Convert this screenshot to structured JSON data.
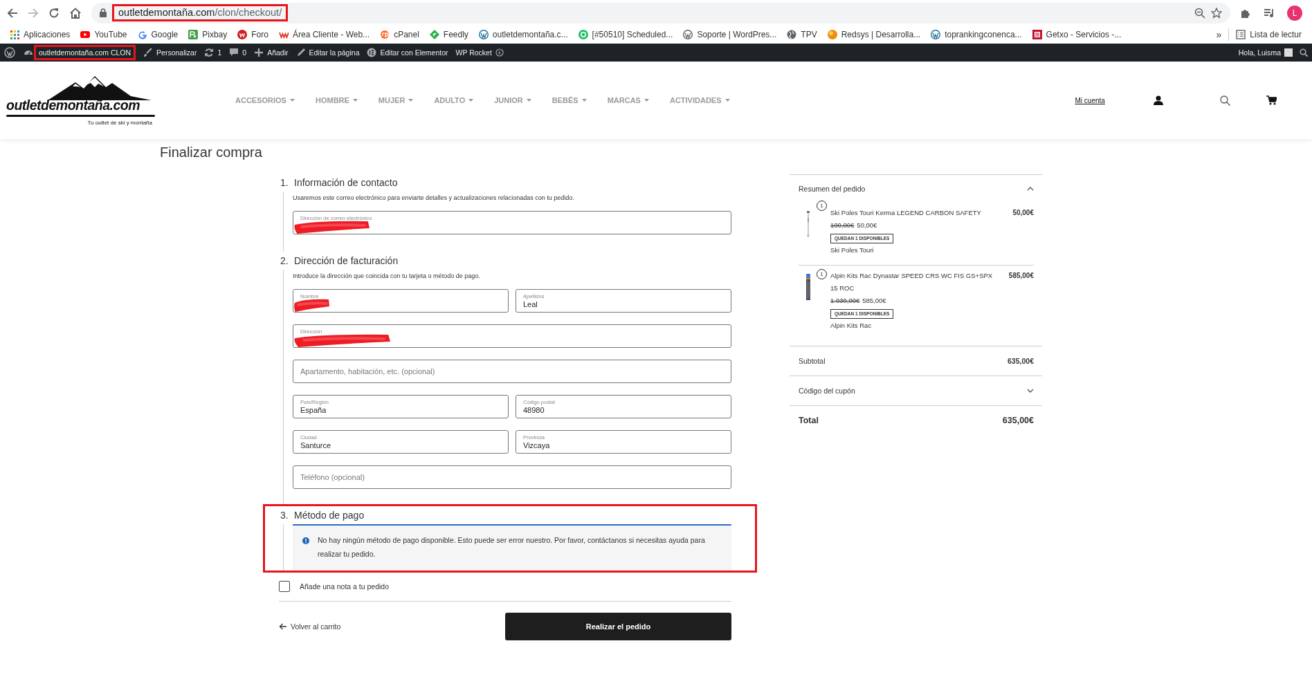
{
  "browser": {
    "address": {
      "host": "outletdemontaña.com",
      "path": "/clon/checkout/",
      "highlighted": true
    },
    "profile": "L",
    "bookmarks": [
      "Aplicaciones",
      "YouTube",
      "Google",
      "Pixbay",
      "Foro",
      "Área Cliente - Web...",
      "cPanel",
      "Feedly",
      "outletdemontaña.c...",
      "[#50510] Scheduled...",
      "Soporte | WordPres...",
      "TPV",
      "Redsys | Desarrolla...",
      "toprankingconenca...",
      "Getxo - Servicios -..."
    ],
    "more": "»",
    "reading_list": "Lista de lectur"
  },
  "admin_bar": {
    "items": [
      {
        "kind": "site",
        "label": "outletdemontaña.com CLON",
        "highlighted": true
      },
      {
        "kind": "customize",
        "label": "Personalizar",
        "highlighted": false
      },
      {
        "kind": "updates",
        "label": "1",
        "highlighted": false
      },
      {
        "kind": "comments",
        "label": "0",
        "highlighted": false
      },
      {
        "kind": "new",
        "label": "Añadir",
        "highlighted": false
      },
      {
        "kind": "edit",
        "label": "Editar la página",
        "highlighted": false
      },
      {
        "kind": "elementor",
        "label": "Editar con Elementor",
        "highlighted": false
      },
      {
        "kind": "rocket",
        "label": "WP Rocket",
        "highlighted": false
      }
    ],
    "greeting": "Hola, Luisma"
  },
  "header": {
    "logo": "outletdemontaña.com",
    "tagline": "Tu outlet de ski y montaña",
    "nav": [
      "ACCESORIOS",
      "HOMBRE",
      "MUJER",
      "ADULTO",
      "JUNIOR",
      "BEBÉS",
      "MARCAS",
      "ACTIVIDADES"
    ],
    "account_link": "Mi cuenta"
  },
  "page_title": "Finalizar compra",
  "checkout": {
    "sections": [
      {
        "number": "1.",
        "title": "Información de contacto",
        "highlighted": false,
        "description": "Usaremos este correo electrónico para enviarte detalles y actualizaciones relacionadas con tu pedido.",
        "rows": [
          [
            {
              "label": "Dirección de correo electrónico",
              "redacted": true
            }
          ]
        ]
      },
      {
        "number": "2.",
        "title": "Dirección de facturación",
        "highlighted": false,
        "description": "Introduce la dirección que coincida con tu tarjeta o método de pago.",
        "rows": [
          [
            {
              "label": "Nombre",
              "redacted": true
            },
            {
              "label": "Apellidos",
              "value": "Leal",
              "redacted": false
            }
          ],
          [
            {
              "label": "Dirección",
              "redacted": true
            }
          ],
          [
            {
              "placeholder": "Apartamento, habitación, etc. (opcional)",
              "redacted": false
            }
          ],
          [
            {
              "label": "País/Región",
              "value": "España",
              "redacted": false
            },
            {
              "label": "Código postal",
              "value": "48980",
              "redacted": false
            }
          ],
          [
            {
              "label": "Ciudad",
              "value": "Santurce",
              "redacted": false
            },
            {
              "label": "Provincia",
              "value": "Vizcaya",
              "redacted": false
            }
          ],
          [
            {
              "placeholder": "Teléfono (opcional)",
              "redacted": false
            }
          ]
        ]
      },
      {
        "number": "3.",
        "title": "Método de pago",
        "highlighted": true,
        "notice": "No hay ningún método de pago disponible. Esto puede ser error nuestro. Por favor, contáctanos si necesitas ayuda para realizar tu pedido."
      }
    ],
    "note_checkbox": {
      "label": "Añade una nota a tu pedido",
      "checked": false
    },
    "back_link": "Volver al carrito",
    "submit": "Realizar el pedido"
  },
  "summary": {
    "title": "Resumen del pedido",
    "expanded": true,
    "items": [
      {
        "quantity": "1",
        "name": "Ski Poles Touri Kerma LEGEND CARBON SAFETY",
        "price": "50,00€",
        "old_price": "100,00€",
        "new_price": "50,00€",
        "stock": "QUEDAN 1 DISPONIBLES",
        "variant": "Ski Poles Touri"
      },
      {
        "quantity": "1",
        "name": "Alpin Kits Rac Dynastar SPEED CRS WC FIS GS+SPX 15 ROC",
        "price": "585,00€",
        "old_price": "1.039,00€",
        "new_price": "585,00€",
        "stock": "QUEDAN 1 DISPONIBLES",
        "variant": "Alpin Kits Rac"
      }
    ],
    "subtotal_label": "Subtotal",
    "subtotal": "635,00€",
    "coupon": {
      "label": "Código del cupón",
      "expanded": false
    },
    "total_label": "Total",
    "total": "635,00€"
  }
}
